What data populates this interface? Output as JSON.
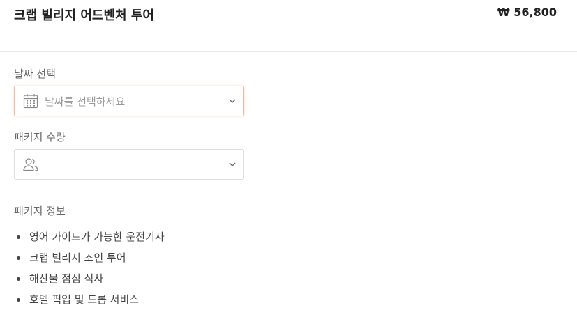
{
  "product": {
    "title": "크랩 빌리지 어드벤처 투어",
    "price": "₩ 56,800"
  },
  "date_field": {
    "label": "날짜 선택",
    "placeholder": "날짜를 선택하세요",
    "icon": "calendar-icon"
  },
  "quantity_field": {
    "label": "패키지 수량",
    "value": "",
    "icon": "users-icon"
  },
  "package_info": {
    "heading": "패키지 정보",
    "items": [
      "영어 가이드가 가능한 운전기사",
      "크랩 빌리지 조인 투어",
      "해산물 점심 식사",
      "호텔 픽업 및 드롭 서비스"
    ]
  },
  "colors": {
    "accent_border": "#f5b7a0",
    "text_primary": "#222222",
    "text_muted": "#999999"
  }
}
